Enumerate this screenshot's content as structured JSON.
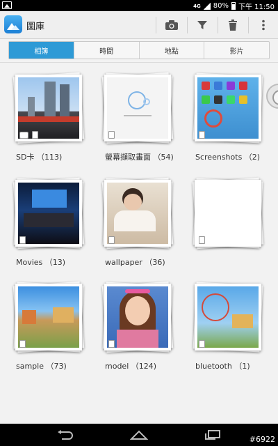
{
  "status": {
    "network": "4G",
    "battery": "80%",
    "time": "下午 11:50"
  },
  "header": {
    "title": "圖庫"
  },
  "icons": {
    "app": "gallery-icon",
    "camera": "camera-icon",
    "filter": "filter-icon",
    "delete": "trash-icon",
    "menu": "overflow-menu-icon"
  },
  "tabs": [
    {
      "label": "相簿",
      "active": true
    },
    {
      "label": "時間",
      "active": false
    },
    {
      "label": "地點",
      "active": false
    },
    {
      "label": "影片",
      "active": false
    }
  ],
  "albums": [
    {
      "label": "SD卡 （113)"
    },
    {
      "label": "螢幕擷取畫面 （54)"
    },
    {
      "label": "Screenshots （2)"
    },
    {
      "label": "Movies （13)"
    },
    {
      "label": "wallpaper （36)"
    },
    {
      "label": ""
    },
    {
      "label": "sample （73)"
    },
    {
      "label": "model （124)"
    },
    {
      "label": "bluetooth （1)"
    }
  ],
  "watermark": "#6922",
  "colors": {
    "accent": "#2e9ad6"
  }
}
